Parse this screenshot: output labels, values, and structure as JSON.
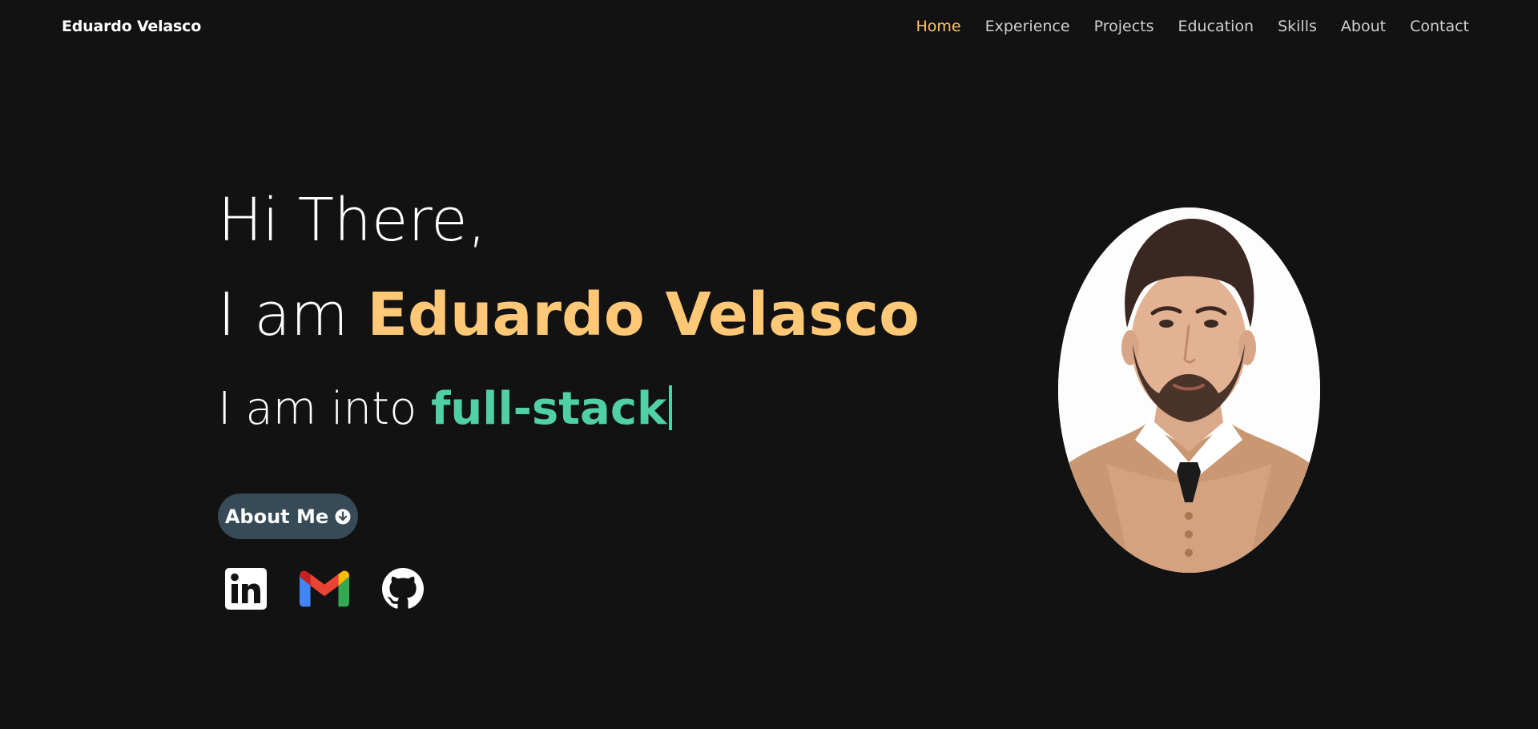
{
  "nav": {
    "brand": "Eduardo Velasco",
    "links": [
      {
        "label": "Home",
        "active": true
      },
      {
        "label": "Experience",
        "active": false
      },
      {
        "label": "Projects",
        "active": false
      },
      {
        "label": "Education",
        "active": false
      },
      {
        "label": "Skills",
        "active": false
      },
      {
        "label": "About",
        "active": false
      },
      {
        "label": "Contact",
        "active": false
      }
    ]
  },
  "hero": {
    "greeting": "Hi There,",
    "intro_prefix": "I am ",
    "name": "Eduardo Velasco",
    "typed_prefix": "I am into ",
    "typed_role": "full-stack"
  },
  "about_button": {
    "label": "About Me",
    "icon": "arrow-circle-down-icon"
  },
  "socials": [
    {
      "name": "linkedin",
      "icon": "linkedin-icon"
    },
    {
      "name": "gmail",
      "icon": "gmail-icon"
    },
    {
      "name": "github",
      "icon": "github-icon"
    }
  ],
  "colors": {
    "background": "#121212",
    "accent_name": "#ffc876",
    "accent_role": "#4fd1a5",
    "active_nav": "#ffc56a",
    "button_bg": "#364a57"
  }
}
